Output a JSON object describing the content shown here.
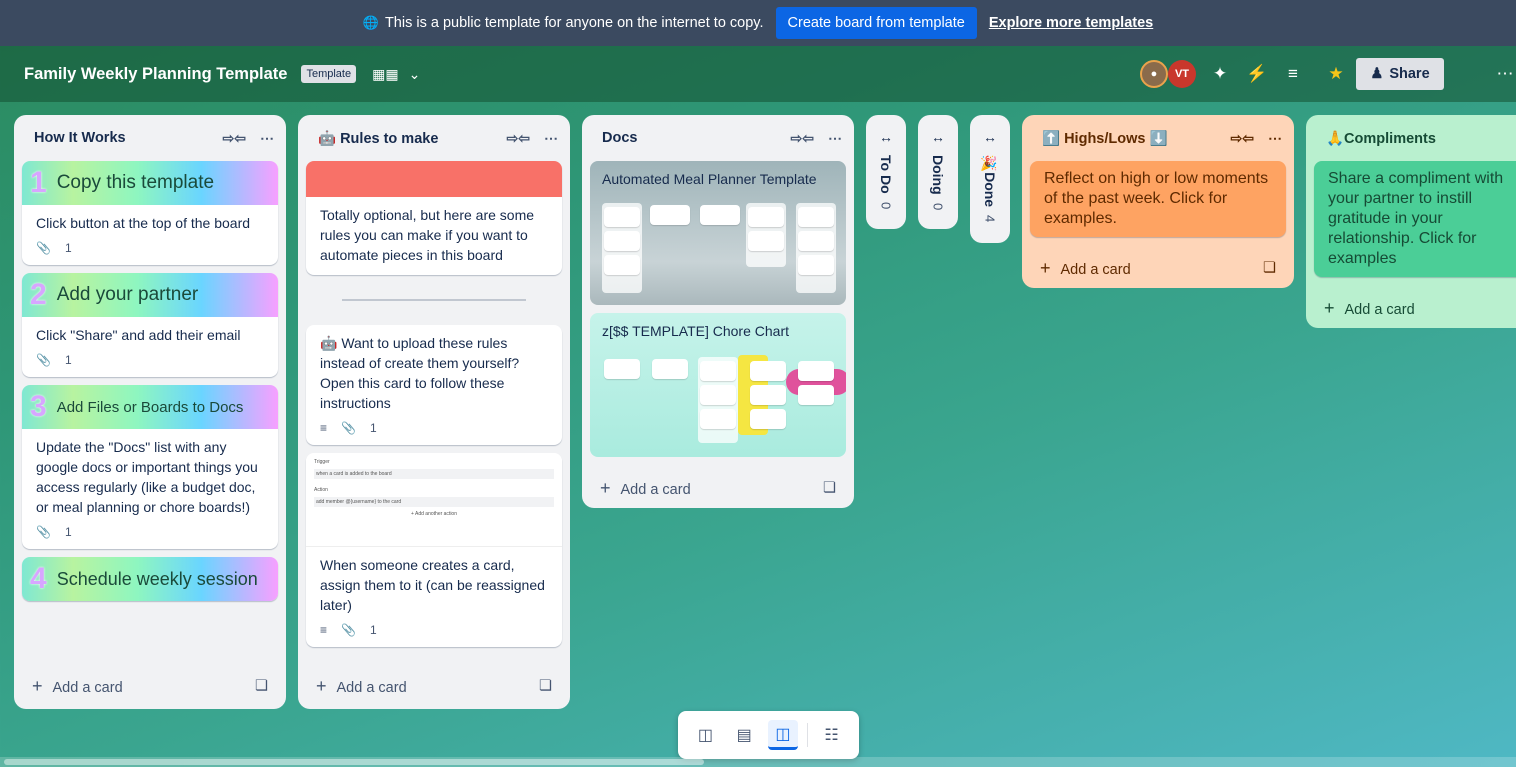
{
  "banner": {
    "message": "This is a public template for anyone on the internet to copy.",
    "cta": "Create board from template",
    "link": "Explore more templates"
  },
  "board": {
    "title": "Family Weekly Planning Template",
    "tag": "Template",
    "share_label": "Share",
    "avatar_initials": "VT"
  },
  "lists": [
    {
      "title": "How It Works",
      "cards": [
        {
          "cover_num": "1",
          "cover_text": "Copy this template",
          "text": "Click button at the top of the board",
          "attachments": "1"
        },
        {
          "cover_num": "2",
          "cover_text": "Add your partner",
          "text": "Click \"Share\" and add their email",
          "attachments": "1"
        },
        {
          "cover_num": "3",
          "cover_text": "Add Files or Boards to Docs",
          "text": "Update the \"Docs\" list with any google docs or important things you access regularly (like a budget doc, or meal planning or chore boards!)",
          "attachments": "1"
        },
        {
          "cover_num": "4",
          "cover_text": "Schedule weekly session"
        }
      ],
      "add_card": "Add a card"
    },
    {
      "title": "🤖 Rules to make",
      "cards": [
        {
          "text": "Totally optional, but here are some rules you can make if you want to automate pieces in this board"
        },
        {
          "text": "🤖 Want to upload these rules instead of create them yourself? Open this card to follow these instructions",
          "attachments": "1"
        },
        {
          "text": "When someone creates a card, assign them to it (can be reassigned later)",
          "attachments": "1",
          "preview": {
            "trigger": "Trigger",
            "trigger_text": "when a card is added to the board",
            "action": "Action",
            "action_text": "add member @{username} to the card",
            "add_action": "+ Add another action"
          }
        }
      ],
      "add_card": "Add a card"
    },
    {
      "title": "Docs",
      "cards": [
        {
          "text": "Automated Meal Planner Template"
        },
        {
          "text": "z[$$ TEMPLATE] Chore Chart"
        }
      ],
      "add_card": "Add a card"
    },
    {
      "title": "⬆️ Highs/Lows ⬇️",
      "cards": [
        {
          "text": "Reflect on high or low moments of the past week. Click for examples."
        }
      ],
      "add_card": "Add a card"
    },
    {
      "title": "🙏Compliments",
      "cards": [
        {
          "text": "Share a compliment with your partner to instill gratitude in your relationship. Click for examples"
        }
      ],
      "add_card": "Add a card"
    }
  ],
  "collapsed_lists": [
    {
      "title": "To Do",
      "count": "0"
    },
    {
      "title": "Doing",
      "count": "0"
    },
    {
      "title": "🎉Done",
      "count": "4"
    }
  ],
  "colors": {
    "banner_bg": "#3b4a60",
    "cta_bg": "#0c66e4",
    "highs_bg": "#fed5b8",
    "highs_card": "#fea362",
    "compliments_bg": "#b9f0cf",
    "compliments_card": "#4bce97",
    "rules_cover": "#f87168"
  },
  "icons": [
    "globe-icon",
    "board-view-icon",
    "chevron-down-icon",
    "power-up-icon",
    "automation-icon",
    "filter-icon",
    "star-icon",
    "visibility-icon",
    "add-person-icon",
    "more-icon",
    "collapse-icon",
    "expand-icon",
    "attachment-icon",
    "description-icon",
    "template-card-icon",
    "inbox-icon",
    "calendar-icon",
    "board-icon",
    "switch-board-icon"
  ]
}
